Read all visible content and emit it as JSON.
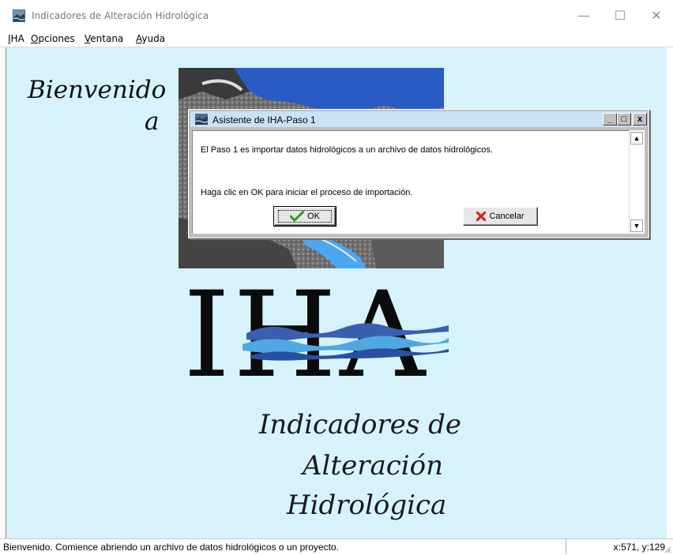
{
  "window": {
    "title": "Indicadores de Alteración Hidrológica",
    "minimize_glyph": "—",
    "maximize_glyph": "☐",
    "close_glyph": "✕"
  },
  "menu": {
    "items": [
      {
        "accel": "I",
        "rest": "HA"
      },
      {
        "accel": "O",
        "rest": "pciones"
      },
      {
        "accel": "V",
        "rest": "entana"
      },
      {
        "accel": "A",
        "rest": "yuda"
      }
    ]
  },
  "splash": {
    "welcome_line1": "Bienvenido",
    "welcome_line2": "a",
    "logo_text": "IHA",
    "subtitle_line1": "Indicadores de",
    "subtitle_line2": "Alteración",
    "subtitle_line3": "Hidrológica"
  },
  "dialog": {
    "title": "Asistente de IHA-Paso 1",
    "btn_min": "_",
    "btn_max": "□",
    "btn_close": "x",
    "message_1": "El Paso 1 es importar datos hidrológicos a un archivo de datos hidrológicos.",
    "message_2": "Haga clic en OK para iniciar el proceso de importación.",
    "ok_label": "OK",
    "cancel_label": "Cancelar",
    "scroll_up_glyph": "▲",
    "scroll_down_glyph": "▼"
  },
  "statusbar": {
    "message": "Bienvenido. Comience abriendo un archivo de datos hidrológicos o un proyecto.",
    "coords": "x:571, y:129"
  },
  "icons": {
    "app": "app-river-icon",
    "ok": "check-icon",
    "cancel": "red-x-icon"
  },
  "colors": {
    "client_bg": "#d6f3fc",
    "dialog_title_bg": "#c9e2f8",
    "ok_check": "#2e9d1f",
    "cancel_x": "#d02010",
    "water_blue": "#3b7fd1"
  }
}
